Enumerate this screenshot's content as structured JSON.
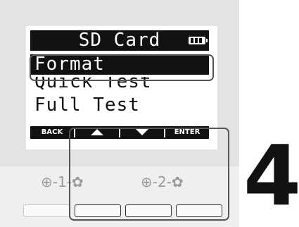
{
  "screen": {
    "title": "SD Card",
    "menu_items": [
      "Format",
      "Quick Test",
      "Full Test"
    ],
    "selected_index": 0
  },
  "softkeys": {
    "back": "BACK",
    "up_icon": "triangle-up-icon",
    "down_icon": "triangle-down-icon",
    "enter": "ENTER"
  },
  "track_labels": {
    "left": "⊕-1-✿",
    "right": "⊕-2-✿"
  },
  "step_number": "4",
  "colors": {
    "lcd_dark": "#111111",
    "lcd_light": "#ffffff",
    "device_body": "#e3e3e3",
    "callout_outline": "#555555"
  }
}
